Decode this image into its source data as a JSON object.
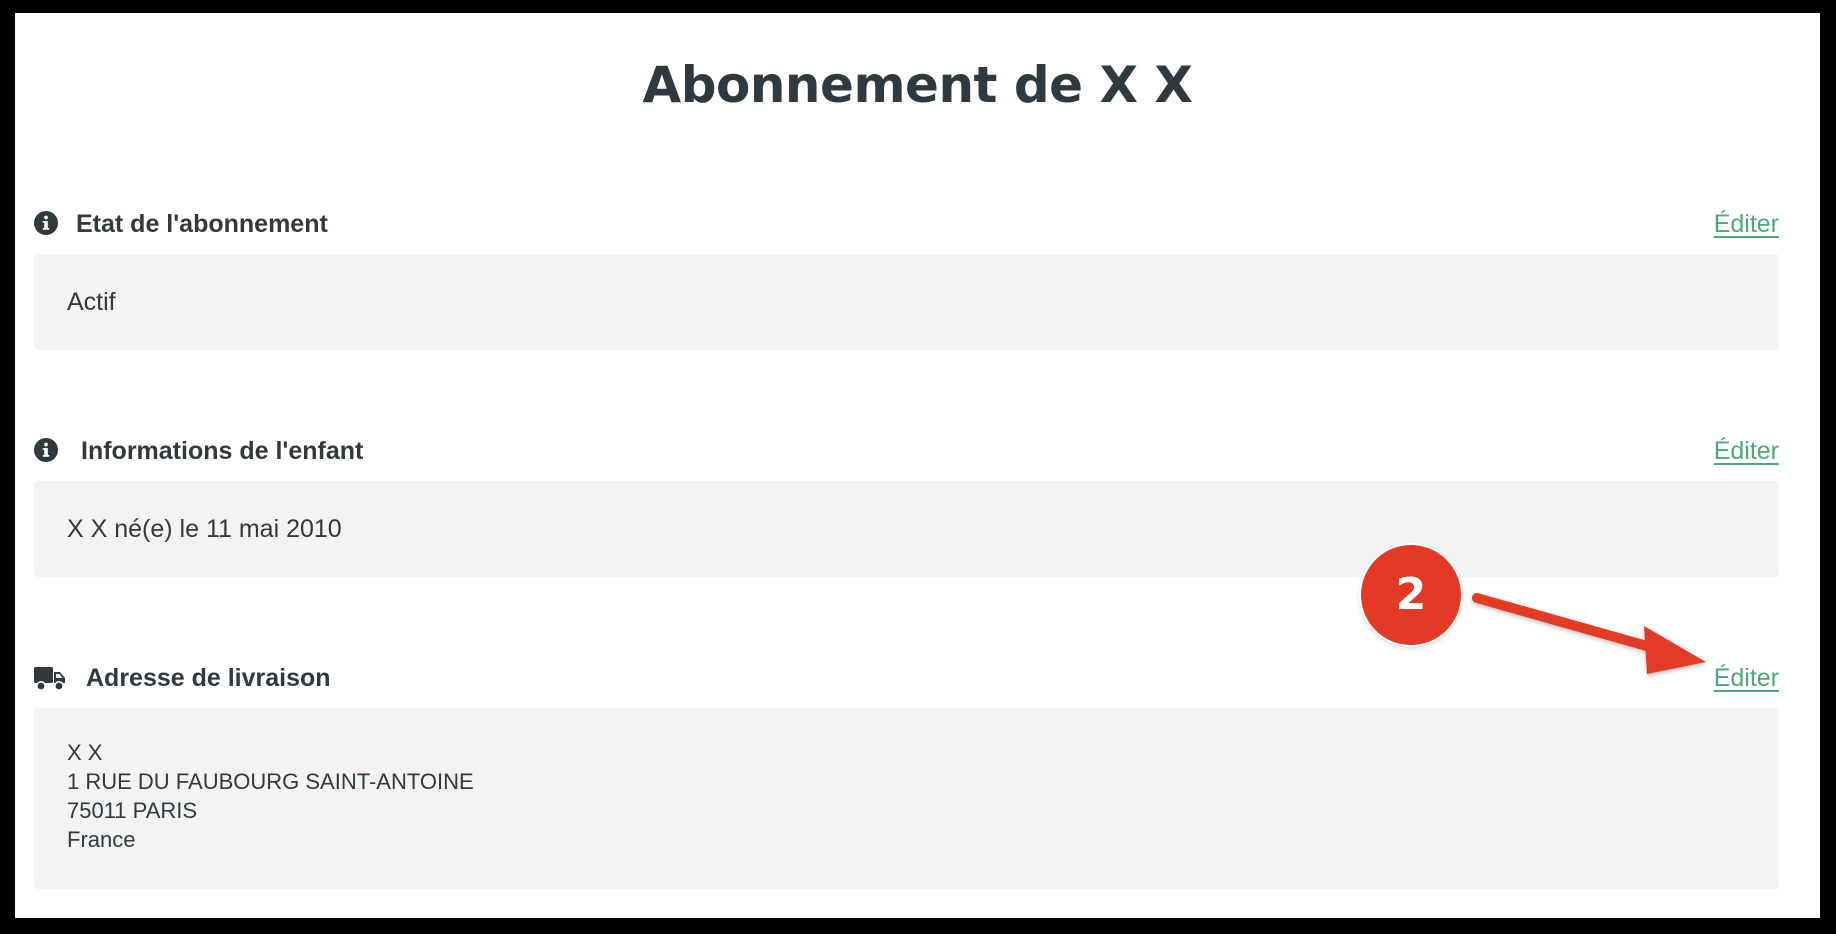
{
  "page": {
    "title": "Abonnement de X X"
  },
  "sections": [
    {
      "title": "Etat de l'abonnement",
      "icon": "info-icon",
      "edit_label": "Éditer",
      "content": "Actif"
    },
    {
      "title": "Informations de l'enfant",
      "icon": "info-icon",
      "edit_label": "Éditer",
      "content": "X X né(e) le 11 mai 2010"
    },
    {
      "title": "Adresse de livraison",
      "icon": "truck-icon",
      "edit_label": "Éditer",
      "address_lines": [
        "X X",
        "1 RUE DU FAUBOURG SAINT-ANTOINE",
        "75011 PARIS",
        "France"
      ]
    }
  ],
  "annotation": {
    "step_number": "2",
    "color": "#e33a26"
  },
  "colors": {
    "text": "#2f3a40",
    "link": "#4ea878",
    "box_background": "#f3f3f3",
    "frame_border": "#000000"
  }
}
